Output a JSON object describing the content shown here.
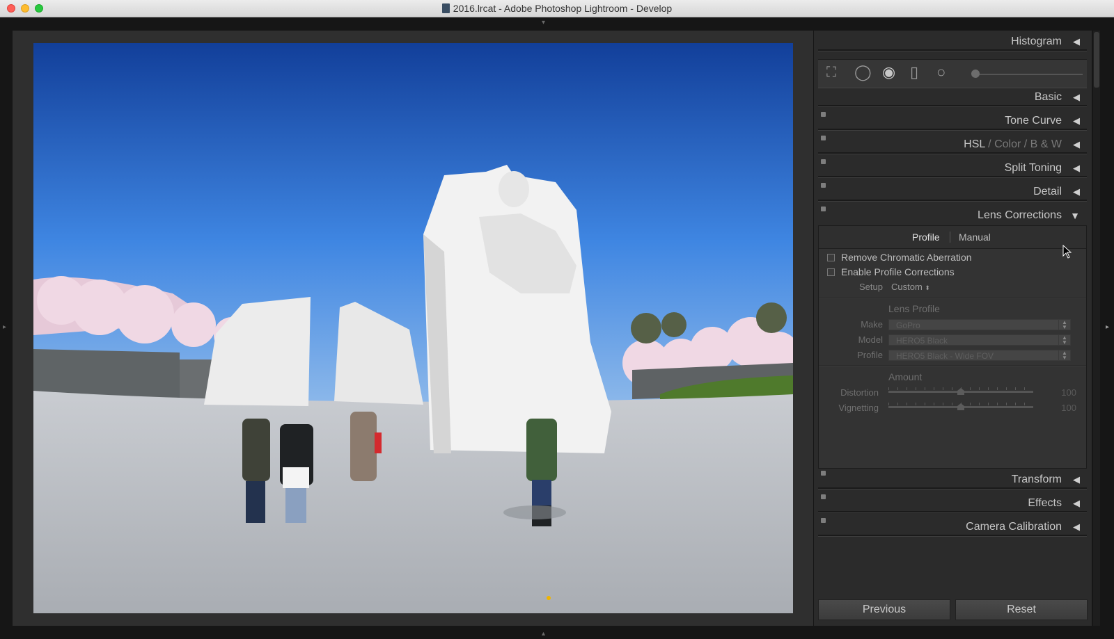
{
  "window": {
    "title": "2016.lrcat - Adobe Photoshop Lightroom - Develop"
  },
  "colors": {
    "panel_bg": "#2b2b2b",
    "text": "#c7c7c7",
    "dim_text": "#6f6f6f",
    "sky": "#1d54b8"
  },
  "panels": {
    "histogram": "Histogram",
    "basic": "Basic",
    "tone_curve": "Tone Curve",
    "hsl": {
      "hsl": "HSL",
      "sep1": "/",
      "color": "Color",
      "sep2": "/",
      "bw": "B & W"
    },
    "split_toning": "Split Toning",
    "detail": "Detail",
    "lens_corrections": "Lens Corrections",
    "transform": "Transform",
    "effects": "Effects",
    "camera_calibration": "Camera Calibration"
  },
  "lens": {
    "tabs": {
      "profile": "Profile",
      "manual": "Manual"
    },
    "remove_ca": "Remove Chromatic Aberration",
    "enable_profile": "Enable Profile Corrections",
    "setup_label": "Setup",
    "setup_value": "Custom",
    "lens_profile_header": "Lens Profile",
    "make_label": "Make",
    "make_value": "GoPro",
    "model_label": "Model",
    "model_value": "HERO5 Black",
    "profile_label": "Profile",
    "profile_value": "HERO5 Black - Wide FOV",
    "amount_header": "Amount",
    "distortion_label": "Distortion",
    "distortion_value": "100",
    "vignetting_label": "Vignetting",
    "vignetting_value": "100",
    "distortion_slider_fraction": 0.5,
    "vignetting_slider_fraction": 0.5
  },
  "buttons": {
    "previous": "Previous",
    "reset": "Reset"
  },
  "icons": [
    "crop-overlay-icon",
    "spot-removal-icon",
    "red-eye-icon",
    "graduated-filter-icon",
    "radial-filter-icon",
    "adjustment-brush-icon"
  ]
}
